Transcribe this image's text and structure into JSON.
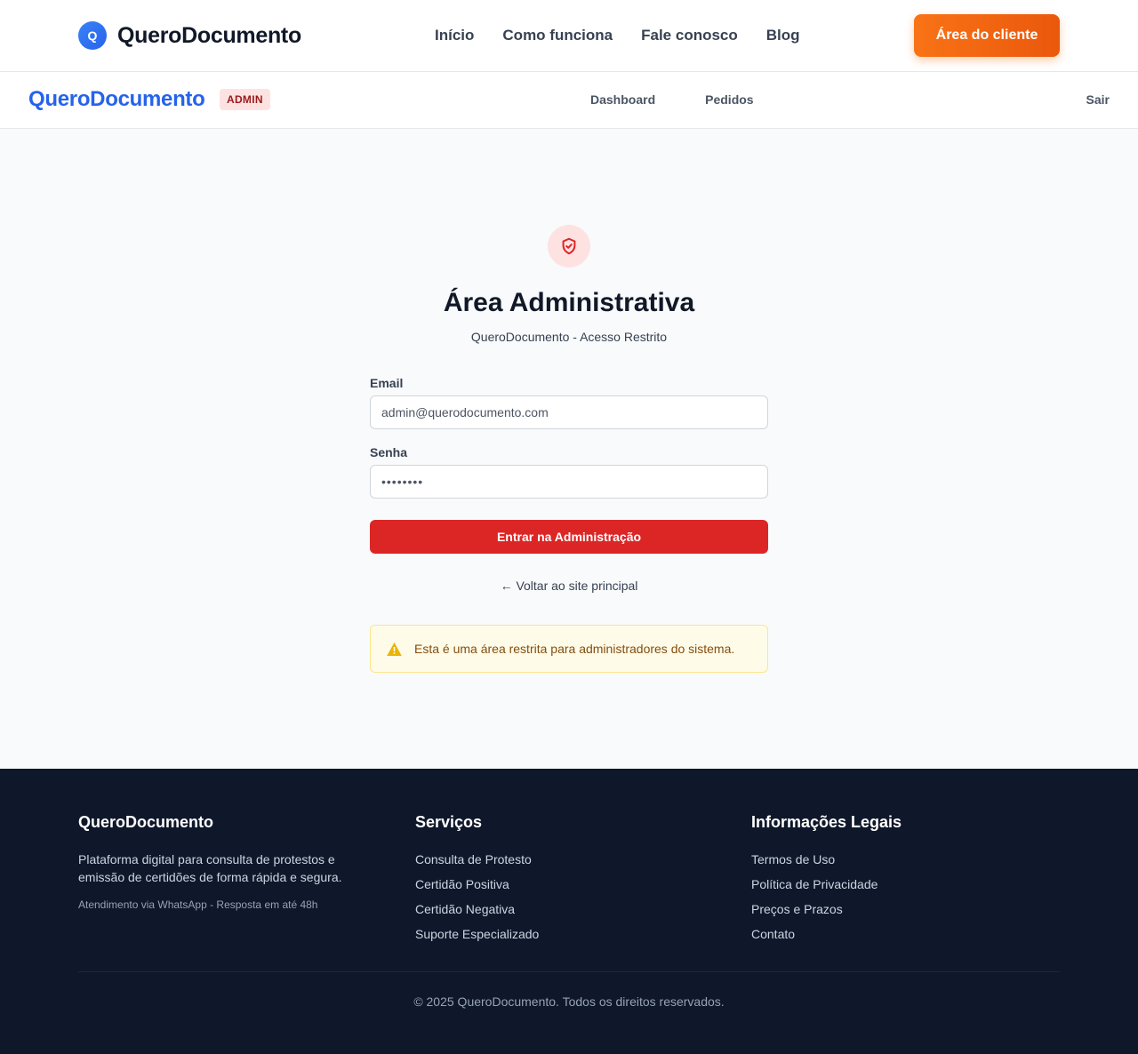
{
  "site_header": {
    "logo_letter": "Q",
    "brand": "QueroDocumento",
    "nav": [
      "Início",
      "Como funciona",
      "Fale conosco",
      "Blog"
    ],
    "client_button": "Área do cliente"
  },
  "admin_bar": {
    "brand": "QueroDocumento",
    "badge": "ADMIN",
    "nav": [
      "Dashboard",
      "Pedidos"
    ],
    "logout": "Sair"
  },
  "login": {
    "title": "Área Administrativa",
    "subtitle": "QueroDocumento - Acesso Restrito",
    "email_label": "Email",
    "email_placeholder": "admin@querodocumento.com",
    "password_label": "Senha",
    "password_placeholder": "••••••••",
    "submit": "Entrar na Administração",
    "back": "← Voltar ao site principal",
    "warning": "Esta é uma área restrita para administradores do sistema."
  },
  "footer": {
    "about": {
      "title": "QueroDocumento",
      "description": "Plataforma digital para consulta de protestos e emissão de certidões de forma rápida e segura.",
      "note": "Atendimento via WhatsApp - Resposta em até 48h"
    },
    "services": {
      "title": "Serviços",
      "items": [
        "Consulta de Protesto",
        "Certidão Positiva",
        "Certidão Negativa",
        "Suporte Especializado"
      ]
    },
    "legal": {
      "title": "Informações Legais",
      "items": [
        "Termos de Uso",
        "Política de Privacidade",
        "Preços e Prazos",
        "Contato"
      ]
    },
    "copyright": "© 2025 QueroDocumento. Todos os direitos reservados."
  },
  "colors": {
    "brand_blue": "#2563eb",
    "accent_orange": "#f97316",
    "danger_red": "#dc2626",
    "footer_bg": "#0f172a"
  }
}
